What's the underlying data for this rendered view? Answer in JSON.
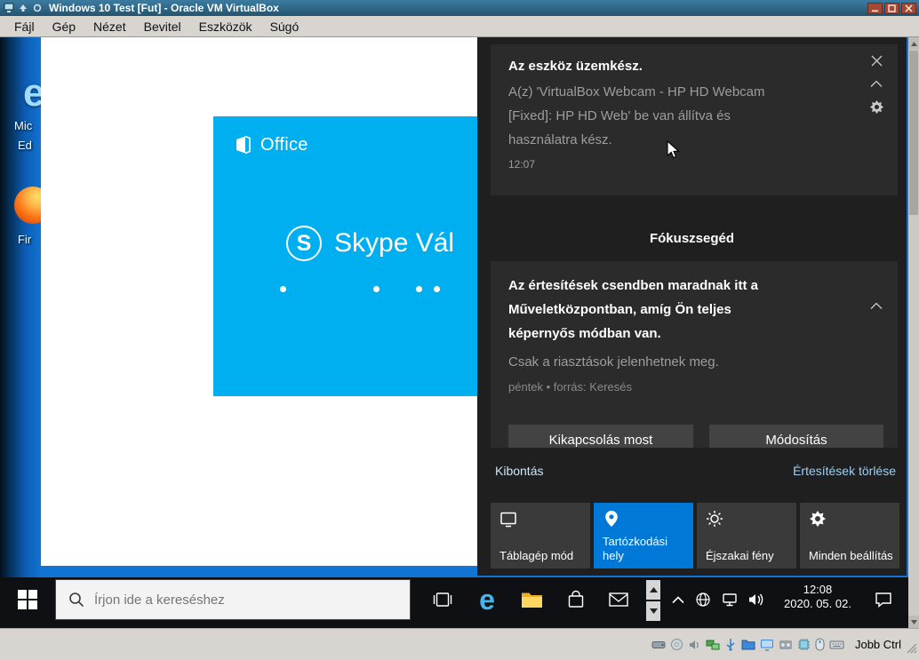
{
  "window": {
    "title": "Windows 10 Test [Fut] - Oracle VM VirtualBox",
    "menu_items": [
      "Fájl",
      "Gép",
      "Nézet",
      "Bevitel",
      "Eszközök",
      "Súgó"
    ],
    "host_key": "Jobb Ctrl"
  },
  "desktop": {
    "edge_label_line1": "Mic",
    "edge_label_line2": "Ed",
    "firefox_label": "Fir"
  },
  "installer": {
    "brand": "Office",
    "product": "Skype Vál",
    "logo_letter": "S"
  },
  "icons": {
    "edge_glyph": "e"
  },
  "action_center": {
    "notification_device": {
      "title": "Az eszköz üzemkész.",
      "body_line1": "A(z) 'VirtualBox Webcam - HP HD Webcam",
      "body_line2": "[Fixed]: HP HD Web' be van állítva és",
      "body_line3": "használatra kész.",
      "time": "12:07"
    },
    "focus_assist_header": "Fókuszsegéd",
    "notification_focus": {
      "title_line1": "Az értesítések csendben maradnak itt a",
      "title_line2": "Műveletközpontban, amíg Ön teljes",
      "title_line3": "képernyős módban van.",
      "body": "Csak a riasztások jelenhetnek meg.",
      "meta": "péntek • forrás: Keresés",
      "button_primary": "Kikapcsolás most",
      "button_secondary": "Módosítás"
    },
    "expand_link": "Kibontás",
    "clear_link": "Értesítések törlése",
    "tiles": {
      "tablet": "Táblagép mód",
      "location": "Tartózkodási hely",
      "nightlight": "Éjszakai fény",
      "settings": "Minden beállítás"
    }
  },
  "taskbar": {
    "search_placeholder": "Írjon ide a kereséshez",
    "clock": {
      "time": "12:08",
      "date": "2020. 05. 02."
    }
  },
  "colors": {
    "accent_blue": "#0078d7",
    "skype_cyan": "#00aff0",
    "desktop_blue": "#1173d2",
    "action_center_bg": "#1f1f1f",
    "notification_card_bg": "#2b2b2b",
    "taskbar_bg": "#0e1013",
    "titlebar_bg": "#2f6b8f"
  }
}
